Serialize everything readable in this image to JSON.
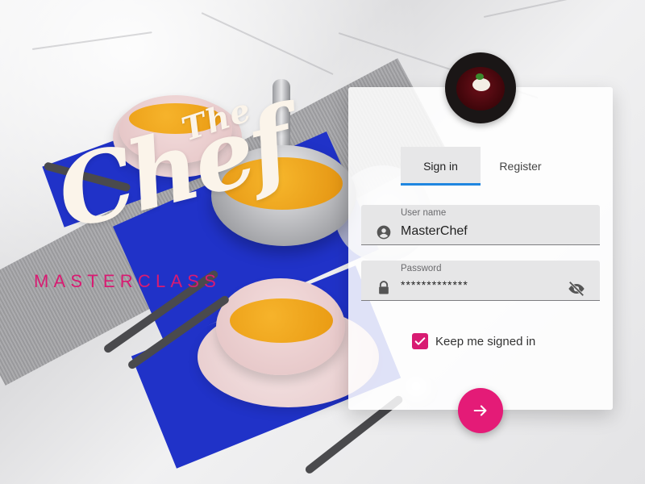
{
  "brand": {
    "the": "The",
    "chef": "Chef",
    "subtitle": "MASTERCLASS",
    "accent_color": "#d81b72"
  },
  "login": {
    "avatar_icon": "dish-photo",
    "tabs": [
      {
        "label": "Sign in",
        "active": true
      },
      {
        "label": "Register",
        "active": false
      }
    ],
    "username": {
      "label": "User name",
      "value": "MasterChef",
      "icon": "account-circle-icon"
    },
    "password": {
      "label": "Password",
      "value": "*************",
      "icon": "lock-icon",
      "toggle_icon": "eye-off-icon"
    },
    "keep_signed_in": {
      "label": "Keep me signed in",
      "checked": true
    },
    "submit": {
      "icon": "arrow-right-icon",
      "color": "#e41b77"
    },
    "tab_indicator_color": "#1f86e0"
  }
}
